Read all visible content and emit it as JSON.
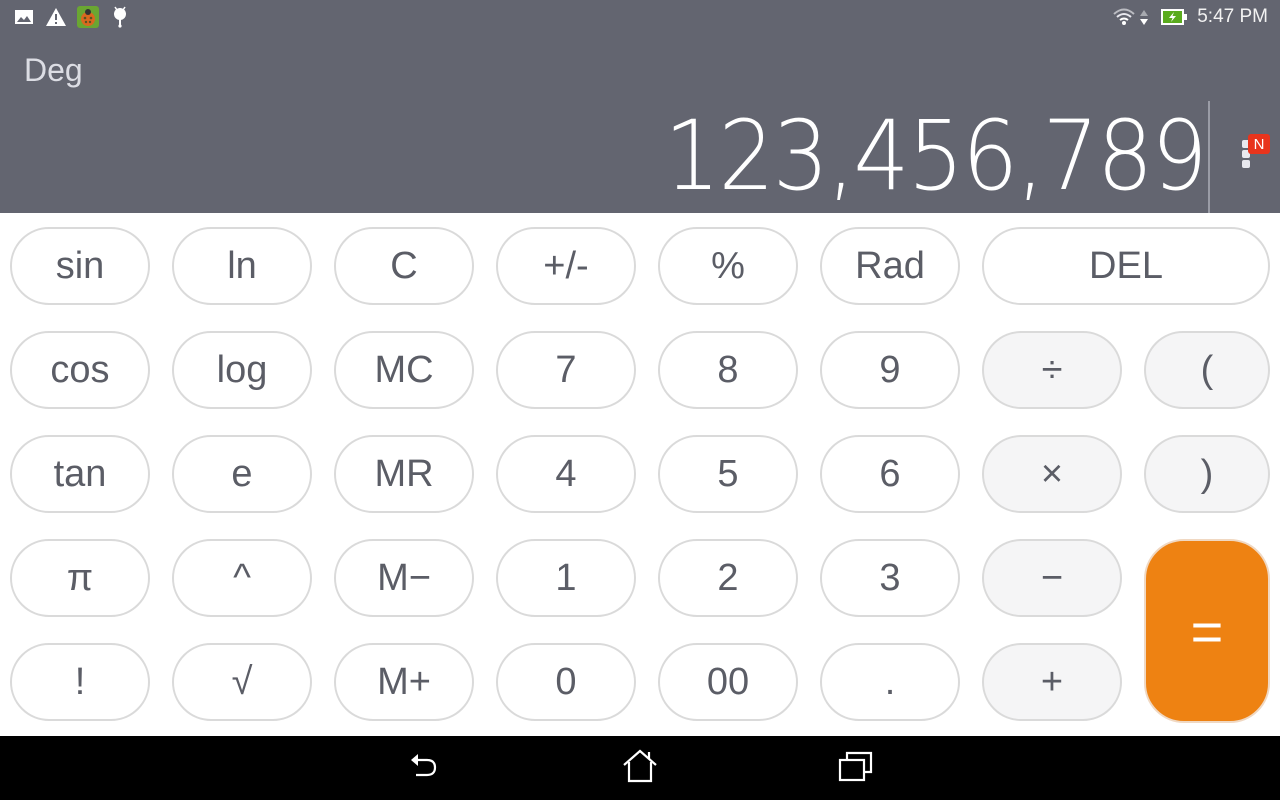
{
  "statusbar": {
    "left_icons": [
      "gallery-notification-icon",
      "warning-icon",
      "ladybug-app-icon",
      "android-debug-icon"
    ],
    "right_icons": [
      "wifi-icon",
      "data-activity-icon",
      "battery-charging-icon"
    ],
    "time": "5:47 PM"
  },
  "display": {
    "angle_mode": "Deg",
    "value": "123,456,789",
    "menu_badge": "N"
  },
  "keys": [
    {
      "label": "sin",
      "name": "sin-key",
      "type": "fn"
    },
    {
      "label": "ln",
      "name": "ln-key",
      "type": "fn"
    },
    {
      "label": "C",
      "name": "clear-key",
      "type": "fn"
    },
    {
      "label": "+/-",
      "name": "negate-key",
      "type": "fn"
    },
    {
      "label": "%",
      "name": "percent-key",
      "type": "fn"
    },
    {
      "label": "Rad",
      "name": "rad-key",
      "type": "fn"
    },
    {
      "label": "DEL",
      "name": "delete-key",
      "type": "fn"
    },
    {
      "label": "cos",
      "name": "cos-key",
      "type": "fn"
    },
    {
      "label": "log",
      "name": "log-key",
      "type": "fn"
    },
    {
      "label": "MC",
      "name": "memory-clear-key",
      "type": "fn"
    },
    {
      "label": "7",
      "name": "digit-7-key",
      "type": "num"
    },
    {
      "label": "8",
      "name": "digit-8-key",
      "type": "num"
    },
    {
      "label": "9",
      "name": "digit-9-key",
      "type": "num"
    },
    {
      "label": "÷",
      "name": "divide-key",
      "type": "op"
    },
    {
      "label": "(",
      "name": "open-paren-key",
      "type": "op"
    },
    {
      "label": "tan",
      "name": "tan-key",
      "type": "fn"
    },
    {
      "label": "e",
      "name": "e-key",
      "type": "fn"
    },
    {
      "label": "MR",
      "name": "memory-recall-key",
      "type": "fn"
    },
    {
      "label": "4",
      "name": "digit-4-key",
      "type": "num"
    },
    {
      "label": "5",
      "name": "digit-5-key",
      "type": "num"
    },
    {
      "label": "6",
      "name": "digit-6-key",
      "type": "num"
    },
    {
      "label": "×",
      "name": "multiply-key",
      "type": "op"
    },
    {
      "label": ")",
      "name": "close-paren-key",
      "type": "op"
    },
    {
      "label": "π",
      "name": "pi-key",
      "type": "fn"
    },
    {
      "label": "^",
      "name": "power-key",
      "type": "fn"
    },
    {
      "label": "M−",
      "name": "memory-minus-key",
      "type": "fn"
    },
    {
      "label": "1",
      "name": "digit-1-key",
      "type": "num"
    },
    {
      "label": "2",
      "name": "digit-2-key",
      "type": "num"
    },
    {
      "label": "3",
      "name": "digit-3-key",
      "type": "num"
    },
    {
      "label": "−",
      "name": "subtract-key",
      "type": "op"
    },
    {
      "label": "=",
      "name": "equals-key",
      "type": "eq"
    },
    {
      "label": "!",
      "name": "factorial-key",
      "type": "fn"
    },
    {
      "label": "√",
      "name": "sqrt-key",
      "type": "fn"
    },
    {
      "label": "M+",
      "name": "memory-plus-key",
      "type": "fn"
    },
    {
      "label": "0",
      "name": "digit-0-key",
      "type": "num"
    },
    {
      "label": "00",
      "name": "double-zero-key",
      "type": "num"
    },
    {
      "label": ".",
      "name": "decimal-key",
      "type": "num"
    },
    {
      "label": "+",
      "name": "add-key",
      "type": "op"
    }
  ],
  "colors": {
    "display_bg": "#636570",
    "equals_bg": "#ee8212",
    "key_text": "#5b5d66",
    "badge": "#e8341c"
  },
  "navbar": {
    "buttons": [
      "back-icon",
      "home-icon",
      "recents-icon"
    ]
  }
}
